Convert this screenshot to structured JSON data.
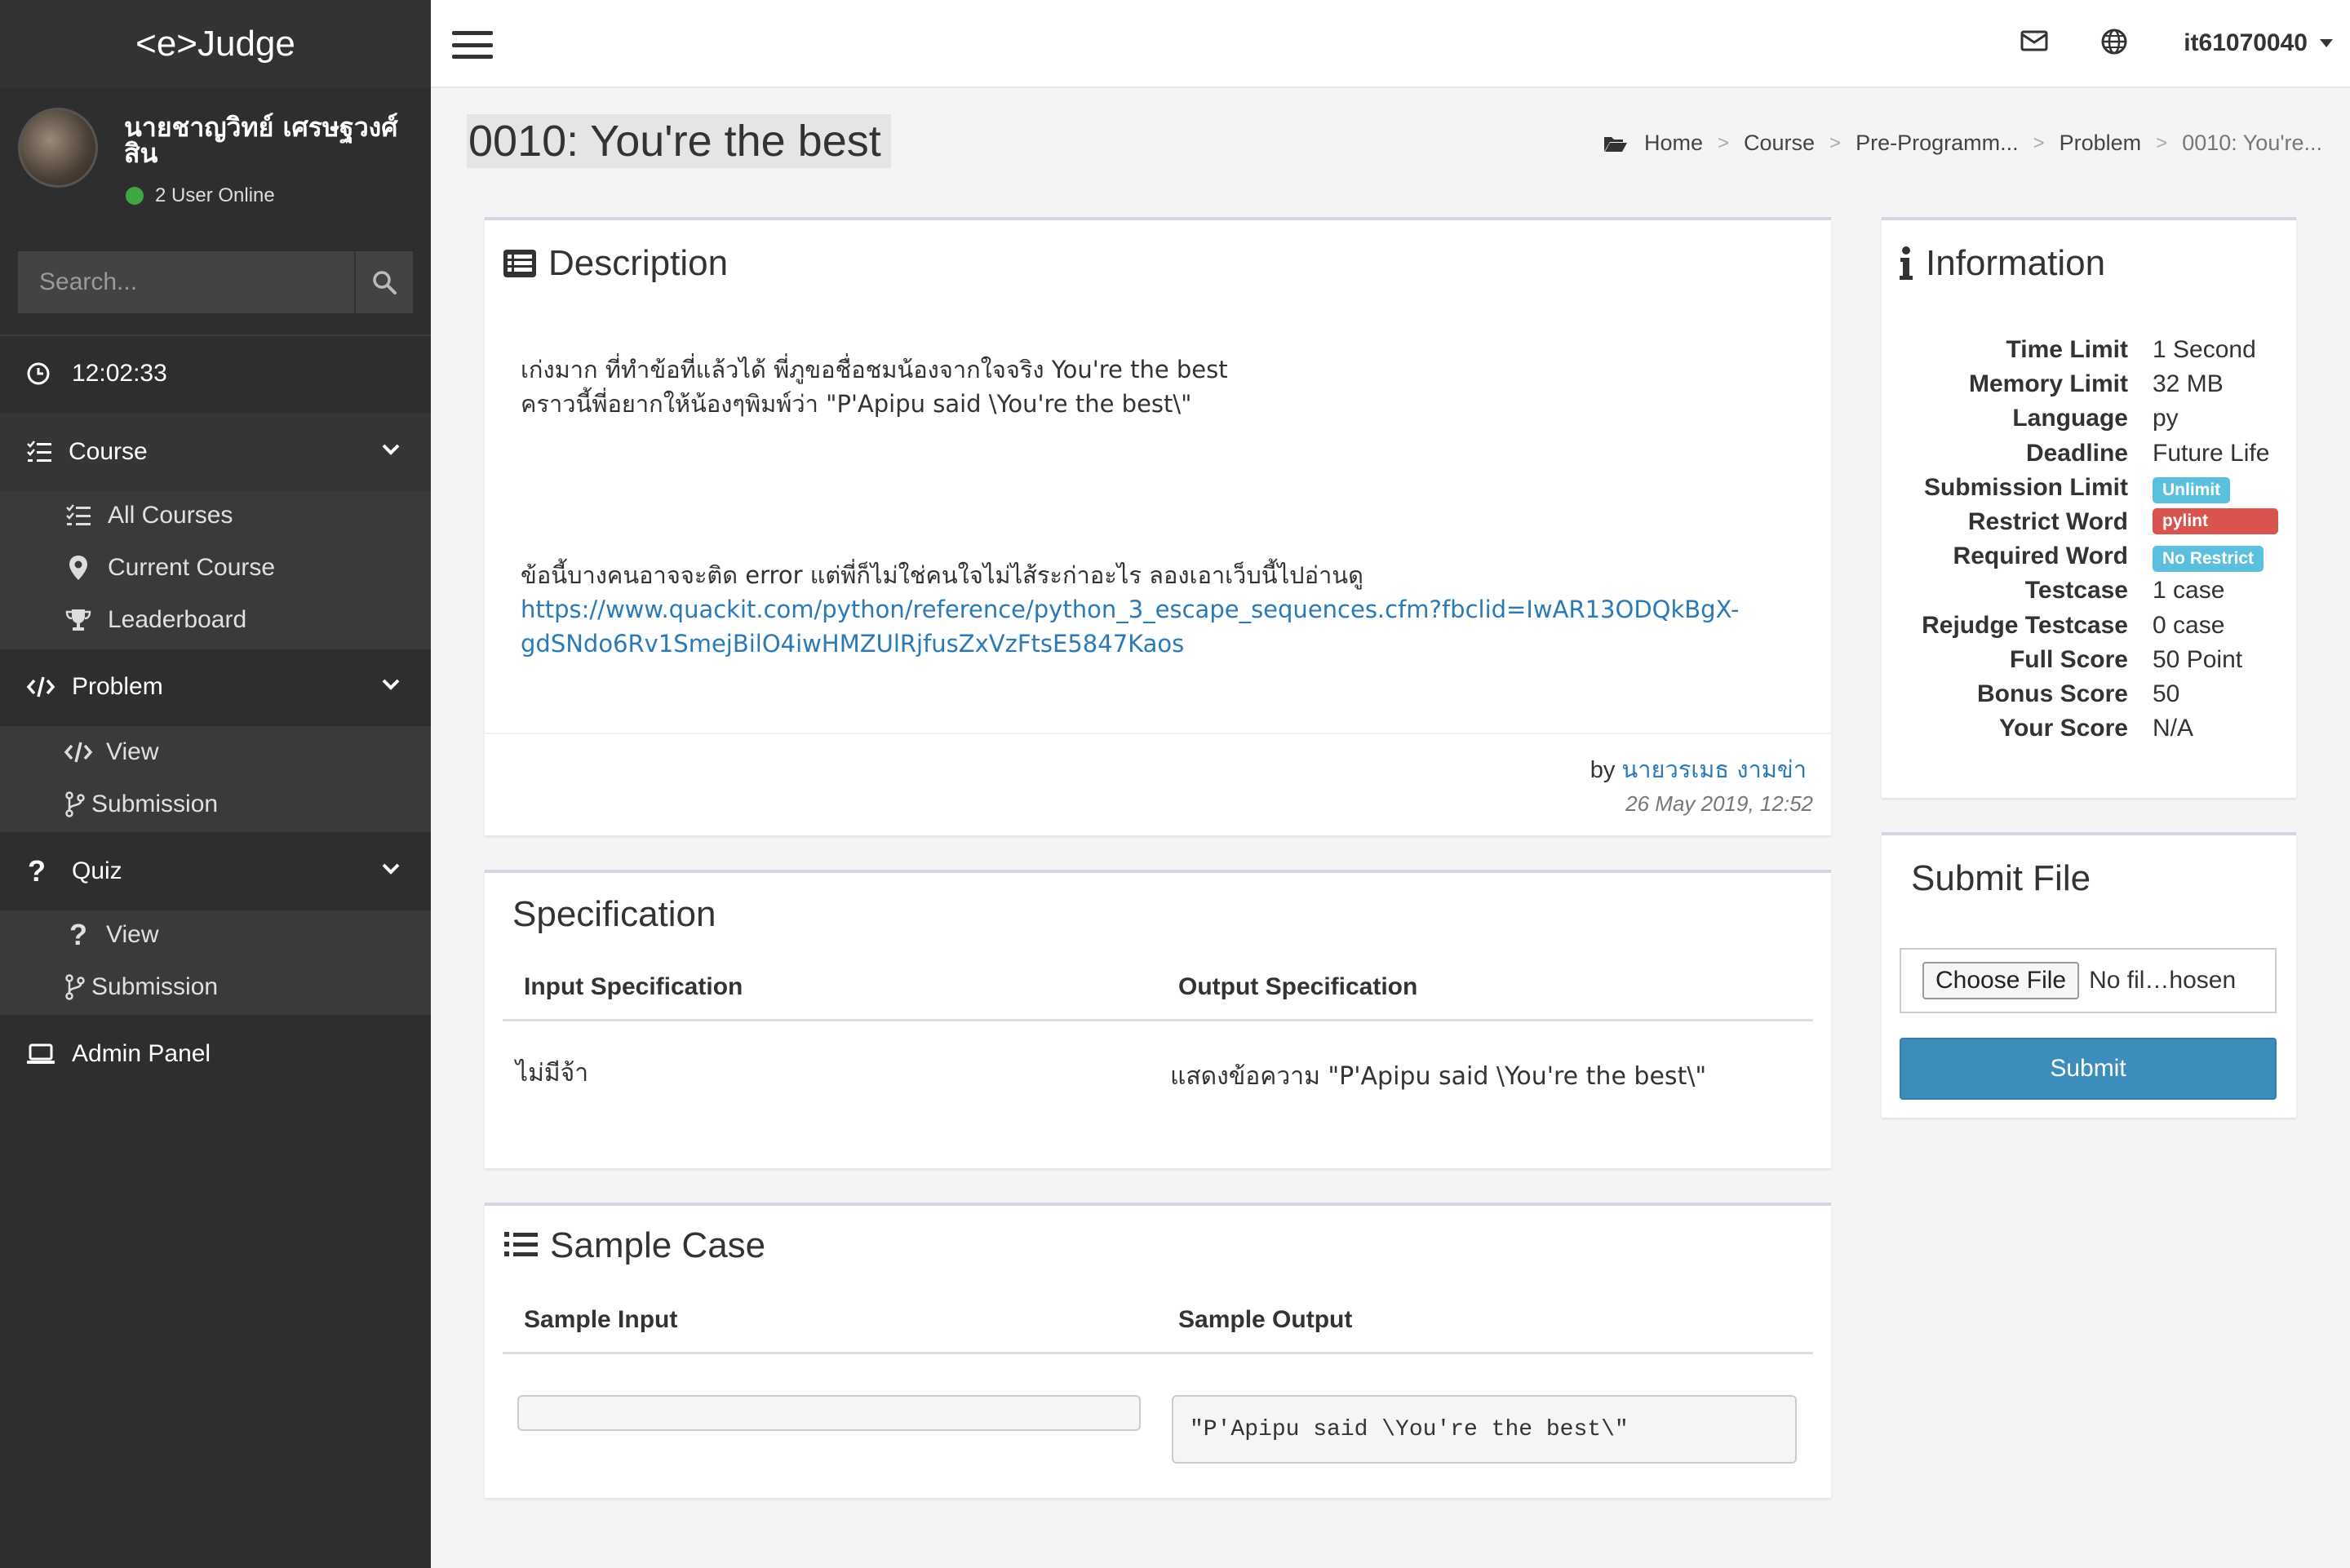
{
  "app": {
    "brand": "<e>Judge"
  },
  "user": {
    "name": "นายชาญวิทย์ เศรษฐวงศ์สิน",
    "online_text": "2 User Online",
    "username": "it61070040"
  },
  "search": {
    "placeholder": "Search..."
  },
  "clock": {
    "time": "12:02:33"
  },
  "nav": {
    "course": {
      "label": "Course",
      "items": [
        "All Courses",
        "Current Course",
        "Leaderboard"
      ]
    },
    "problem": {
      "label": "Problem",
      "items": [
        "View",
        "Submission"
      ]
    },
    "quiz": {
      "label": "Quiz",
      "items": [
        "View",
        "Submission"
      ]
    },
    "admin": {
      "label": "Admin Panel"
    }
  },
  "page": {
    "title": "0010: You're the best"
  },
  "breadcrumb": [
    "Home",
    "Course",
    "Pre-Programm...",
    "Problem",
    "0010: You're..."
  ],
  "description": {
    "title": "Description",
    "line1": "เก่งมาก ที่ทำข้อที่แล้วได้ พี่ภูขอชื่อชมน้องจากใจจริง You're the best",
    "line2": "คราวนี้พี่อยากให้น้องๆพิมพ์ว่า \"P'Apipu said \\You're the best\\\"",
    "line3": "ข้อนี้บางคนอาจจะติด error แต่พี่ก็ไม่ใช่คนใจไม่ไส้ระก่าอะไร ลองเอาเว็บนี้ไปอ่านดู",
    "link_part1": "https://www.quackit.com/python/reference/python_3_escape_sequences.cfm?fbclid=IwAR13ODQkBgX-",
    "link_part2": "gdSNdo6Rv1SmejBilO4iwHMZUlRjfusZxVzFtsE5847Kaos",
    "by_prefix": "by",
    "author": "นายวรเมธ งามข่า",
    "date": "26 May 2019, 12:52"
  },
  "specification": {
    "title": "Specification",
    "input_header": "Input Specification",
    "output_header": "Output Specification",
    "input_value": "ไม่มีจ้า",
    "output_value": "แสดงข้อความ \"P'Apipu said \\You're the best\\\""
  },
  "sample": {
    "title": "Sample Case",
    "input_header": "Sample Input",
    "output_header": "Sample Output",
    "input_value": "",
    "output_value": "\"P'Apipu said \\You're the best\\\""
  },
  "information": {
    "title": "Information",
    "rows": [
      {
        "key": "Time Limit",
        "value": "1 Second"
      },
      {
        "key": "Memory Limit",
        "value": "32 MB"
      },
      {
        "key": "Language",
        "value": "py"
      },
      {
        "key": "Deadline",
        "value": "Future Life"
      },
      {
        "key": "Submission Limit",
        "badge": "Unlimit"
      },
      {
        "key": "Restrict Word",
        "badge": "pylint"
      },
      {
        "key": "Required Word",
        "badge": "No Restrict"
      },
      {
        "key": "Testcase",
        "value": "1 case"
      },
      {
        "key": "Rejudge Testcase",
        "value": "0 case"
      },
      {
        "key": "Full Score",
        "value": "50 Point"
      },
      {
        "key": "Bonus Score",
        "value": "50"
      },
      {
        "key": "Your Score",
        "value": "N/A"
      }
    ],
    "colors": {
      "info_badge": "#5bc0de",
      "danger_badge": "#d9534f"
    }
  },
  "submit_file": {
    "title": "Submit File",
    "choose_label": "Choose File",
    "no_file_label": "No fil…hosen",
    "submit_label": "Submit"
  },
  "colors": {
    "sidebar_bg": "#2e2e2e",
    "primary": "#3c8dbc",
    "link": "#2a7ab8",
    "online": "#3ea743"
  }
}
